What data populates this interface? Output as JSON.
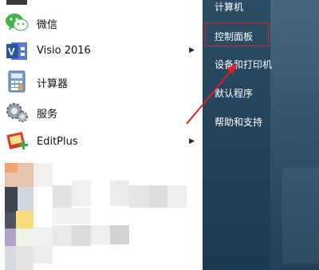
{
  "left_menu": {
    "items": [
      {
        "label": "微信",
        "icon": "wechat-icon",
        "has_submenu": false
      },
      {
        "label": "Visio 2016",
        "icon": "visio-icon",
        "has_submenu": true
      },
      {
        "label": "计算器",
        "icon": "calculator-icon",
        "has_submenu": false
      },
      {
        "label": "服务",
        "icon": "services-gear-icon",
        "has_submenu": false
      },
      {
        "label": "EditPlus",
        "icon": "editplus-icon",
        "has_submenu": true
      }
    ]
  },
  "right_menu": {
    "items": [
      {
        "label": "计算机"
      },
      {
        "label": "控制面板",
        "highlighted": true
      },
      {
        "label": "设备和打印机"
      },
      {
        "label": "默认程序"
      },
      {
        "label": "帮助和支持"
      }
    ]
  },
  "annotation": {
    "color": "#d8242a",
    "target": "控制面板"
  },
  "colors": {
    "right_pane": "#24445c",
    "left_pane": "#ffffff"
  }
}
